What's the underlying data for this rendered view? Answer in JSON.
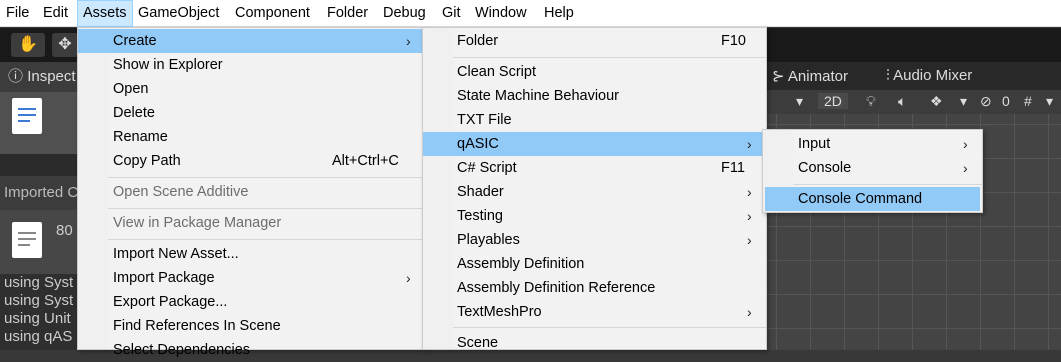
{
  "menubar": {
    "items": [
      {
        "label": "File"
      },
      {
        "label": "Edit"
      },
      {
        "label": "Assets"
      },
      {
        "label": "GameObject"
      },
      {
        "label": "Component"
      },
      {
        "label": "Folder"
      },
      {
        "label": "Debug"
      },
      {
        "label": "Git"
      },
      {
        "label": "Window"
      },
      {
        "label": "Help"
      }
    ],
    "active": "Assets"
  },
  "editor": {
    "inspector_tab": "Inspect",
    "imported_header": "Imported C",
    "imported_value": "80",
    "code_lines": [
      "using Syst",
      "using Syst",
      "using Unit",
      "using qAS"
    ],
    "right_tabs": {
      "animator": "Animator",
      "audio_mixer": "Audio Mixer"
    },
    "scene_toolbar": {
      "mode_2d": "2D",
      "hidden_count": "0"
    }
  },
  "assets_menu": {
    "items": [
      {
        "label": "Create",
        "submenu": true,
        "highlighted": true
      },
      {
        "label": "Show in Explorer"
      },
      {
        "label": "Open"
      },
      {
        "label": "Delete"
      },
      {
        "label": "Rename"
      },
      {
        "label": "Copy Path",
        "shortcut": "Alt+Ctrl+C"
      },
      {
        "label": "Open Scene Additive",
        "disabled": true
      },
      {
        "label": "View in Package Manager",
        "disabled": true
      },
      {
        "label": "Import New Asset..."
      },
      {
        "label": "Import Package",
        "submenu": true
      },
      {
        "label": "Export Package..."
      },
      {
        "label": "Find References In Scene"
      },
      {
        "label": "Select Dependencies"
      }
    ]
  },
  "create_menu": {
    "items": [
      {
        "label": "Folder",
        "shortcut": "F10"
      },
      {
        "label": "Clean Script"
      },
      {
        "label": "State Machine Behaviour"
      },
      {
        "label": "TXT File"
      },
      {
        "label": "qASIC",
        "submenu": true,
        "highlighted": true
      },
      {
        "label": "C# Script",
        "shortcut": "F11"
      },
      {
        "label": "Shader",
        "submenu": true
      },
      {
        "label": "Testing",
        "submenu": true
      },
      {
        "label": "Playables",
        "submenu": true
      },
      {
        "label": "Assembly Definition"
      },
      {
        "label": "Assembly Definition Reference"
      },
      {
        "label": "TextMeshPro",
        "submenu": true
      },
      {
        "label": "Scene"
      }
    ]
  },
  "qasic_menu": {
    "items": [
      {
        "label": "Input",
        "submenu": true
      },
      {
        "label": "Console",
        "submenu": true
      },
      {
        "label": "Console Command",
        "highlighted": true
      }
    ]
  },
  "icons": {
    "submenu_arrow": "›",
    "hand_tool": "hand-icon",
    "move_tool": "move-icon"
  },
  "colors": {
    "menu_highlight": "#91c9f7",
    "menubar_active": "#cce8ff",
    "menu_bg": "#f2f2f2"
  }
}
